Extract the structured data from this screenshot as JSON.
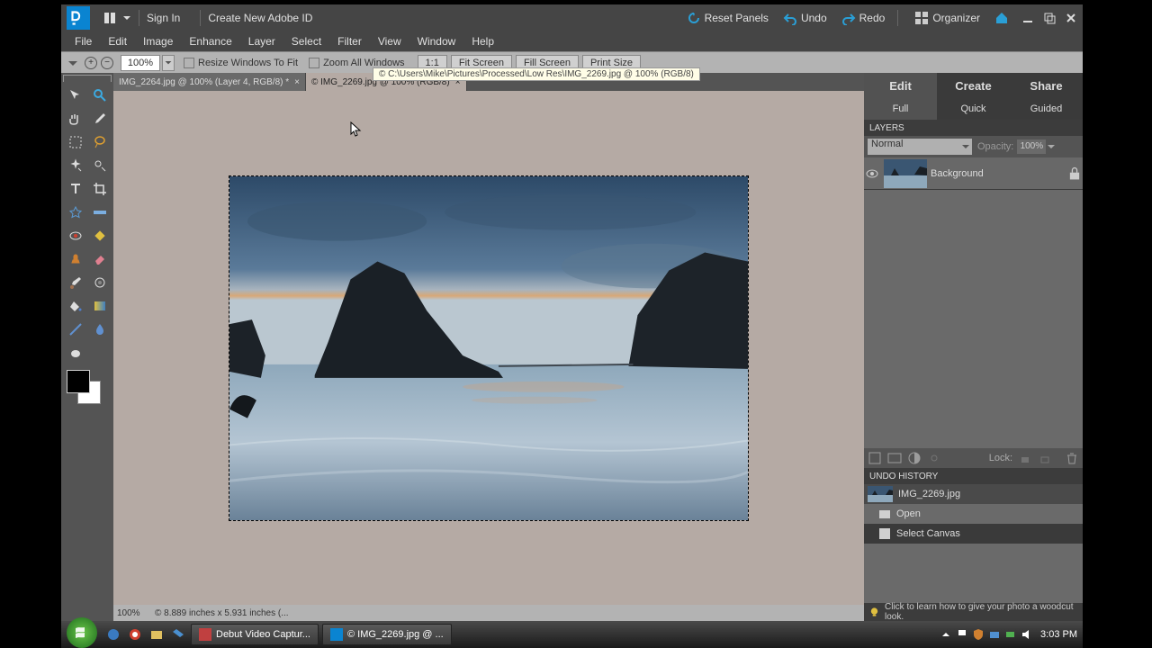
{
  "titlebar": {
    "sign_in": "Sign In",
    "create_id": "Create New Adobe ID",
    "reset_panels": "Reset Panels",
    "undo": "Undo",
    "redo": "Redo",
    "organizer": "Organizer"
  },
  "menu": {
    "file": "File",
    "edit": "Edit",
    "image": "Image",
    "enhance": "Enhance",
    "layer": "Layer",
    "select": "Select",
    "filter": "Filter",
    "view": "View",
    "window": "Window",
    "help": "Help"
  },
  "options": {
    "zoom": "100%",
    "resize_windows": "Resize Windows To Fit",
    "zoom_all": "Zoom All Windows",
    "one_to_one": "1:1",
    "fit_screen": "Fit Screen",
    "fill_screen": "Fill Screen",
    "print_size": "Print Size",
    "tooltip": "© C:\\Users\\Mike\\Pictures\\Processed\\Low Res\\IMG_2269.jpg @ 100% (RGB/8)"
  },
  "doc_tabs": {
    "tab1": "IMG_2264.jpg @ 100% (Layer 4, RGB/8) *",
    "tab2": "© IMG_2269.jpg @ 100% (RGB/8)"
  },
  "status": {
    "zoom": "100%",
    "info": "© 8.889 inches x 5.931 inches (..."
  },
  "panels": {
    "edit": "Edit",
    "create": "Create",
    "share": "Share",
    "full": "Full",
    "quick": "Quick",
    "guided": "Guided",
    "layers_title": "LAYERS",
    "blend_mode": "Normal",
    "opacity_label": "Opacity:",
    "opacity_value": "100%",
    "layer_background": "Background",
    "lock_label": "Lock:",
    "undo_title": "UNDO HISTORY",
    "undo_src": "IMG_2269.jpg",
    "undo_open": "Open",
    "undo_select": "Select Canvas"
  },
  "hint": "Click to learn how to give your photo a woodcut look.",
  "taskbar": {
    "task1": "Debut Video Captur...",
    "task2": "© IMG_2269.jpg @ ...",
    "clock": "3:03 PM"
  }
}
